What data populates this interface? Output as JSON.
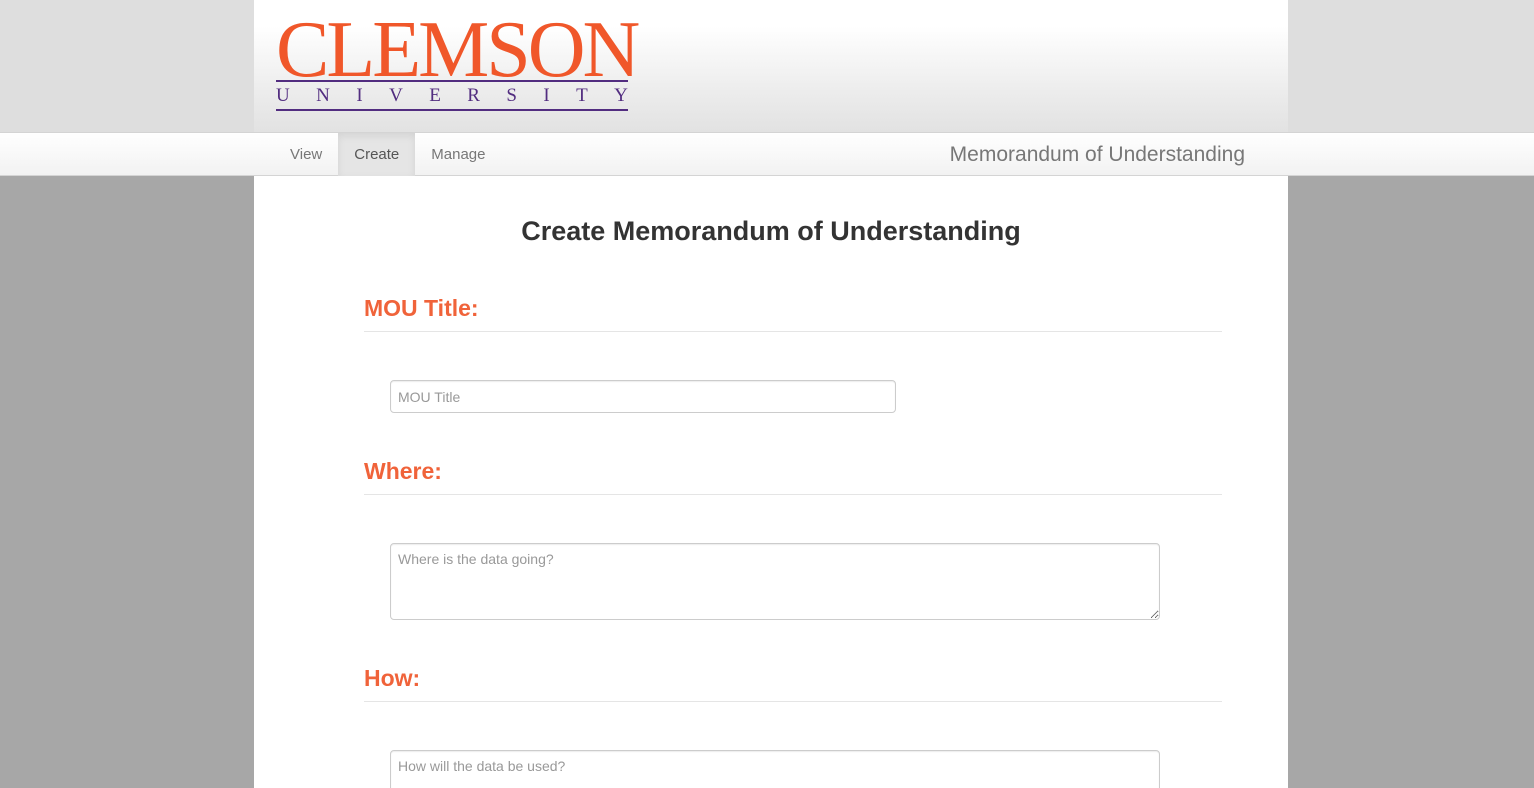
{
  "logo": {
    "wordmark": "CLEMSON",
    "subtitle_letters": [
      "U",
      "N",
      "I",
      "V",
      "E",
      "R",
      "S",
      "I",
      "T",
      "Y"
    ]
  },
  "nav": {
    "items": [
      {
        "label": "View"
      },
      {
        "label": "Create"
      },
      {
        "label": "Manage"
      }
    ],
    "active": "Create",
    "brand": "Memorandum of Understanding"
  },
  "page": {
    "title": "Create Memorandum of Understanding"
  },
  "form": {
    "title_section": {
      "heading": "MOU Title:",
      "value": "",
      "placeholder": "MOU Title"
    },
    "where_section": {
      "heading": "Where:",
      "value": "",
      "placeholder": "Where is the data going?"
    },
    "how_section": {
      "heading": "How:",
      "value": "",
      "placeholder": "How will the data be used?"
    }
  },
  "colors": {
    "brand_orange": "#f0572a",
    "brand_purple": "#522d80",
    "heading_orange": "#f0633a"
  }
}
